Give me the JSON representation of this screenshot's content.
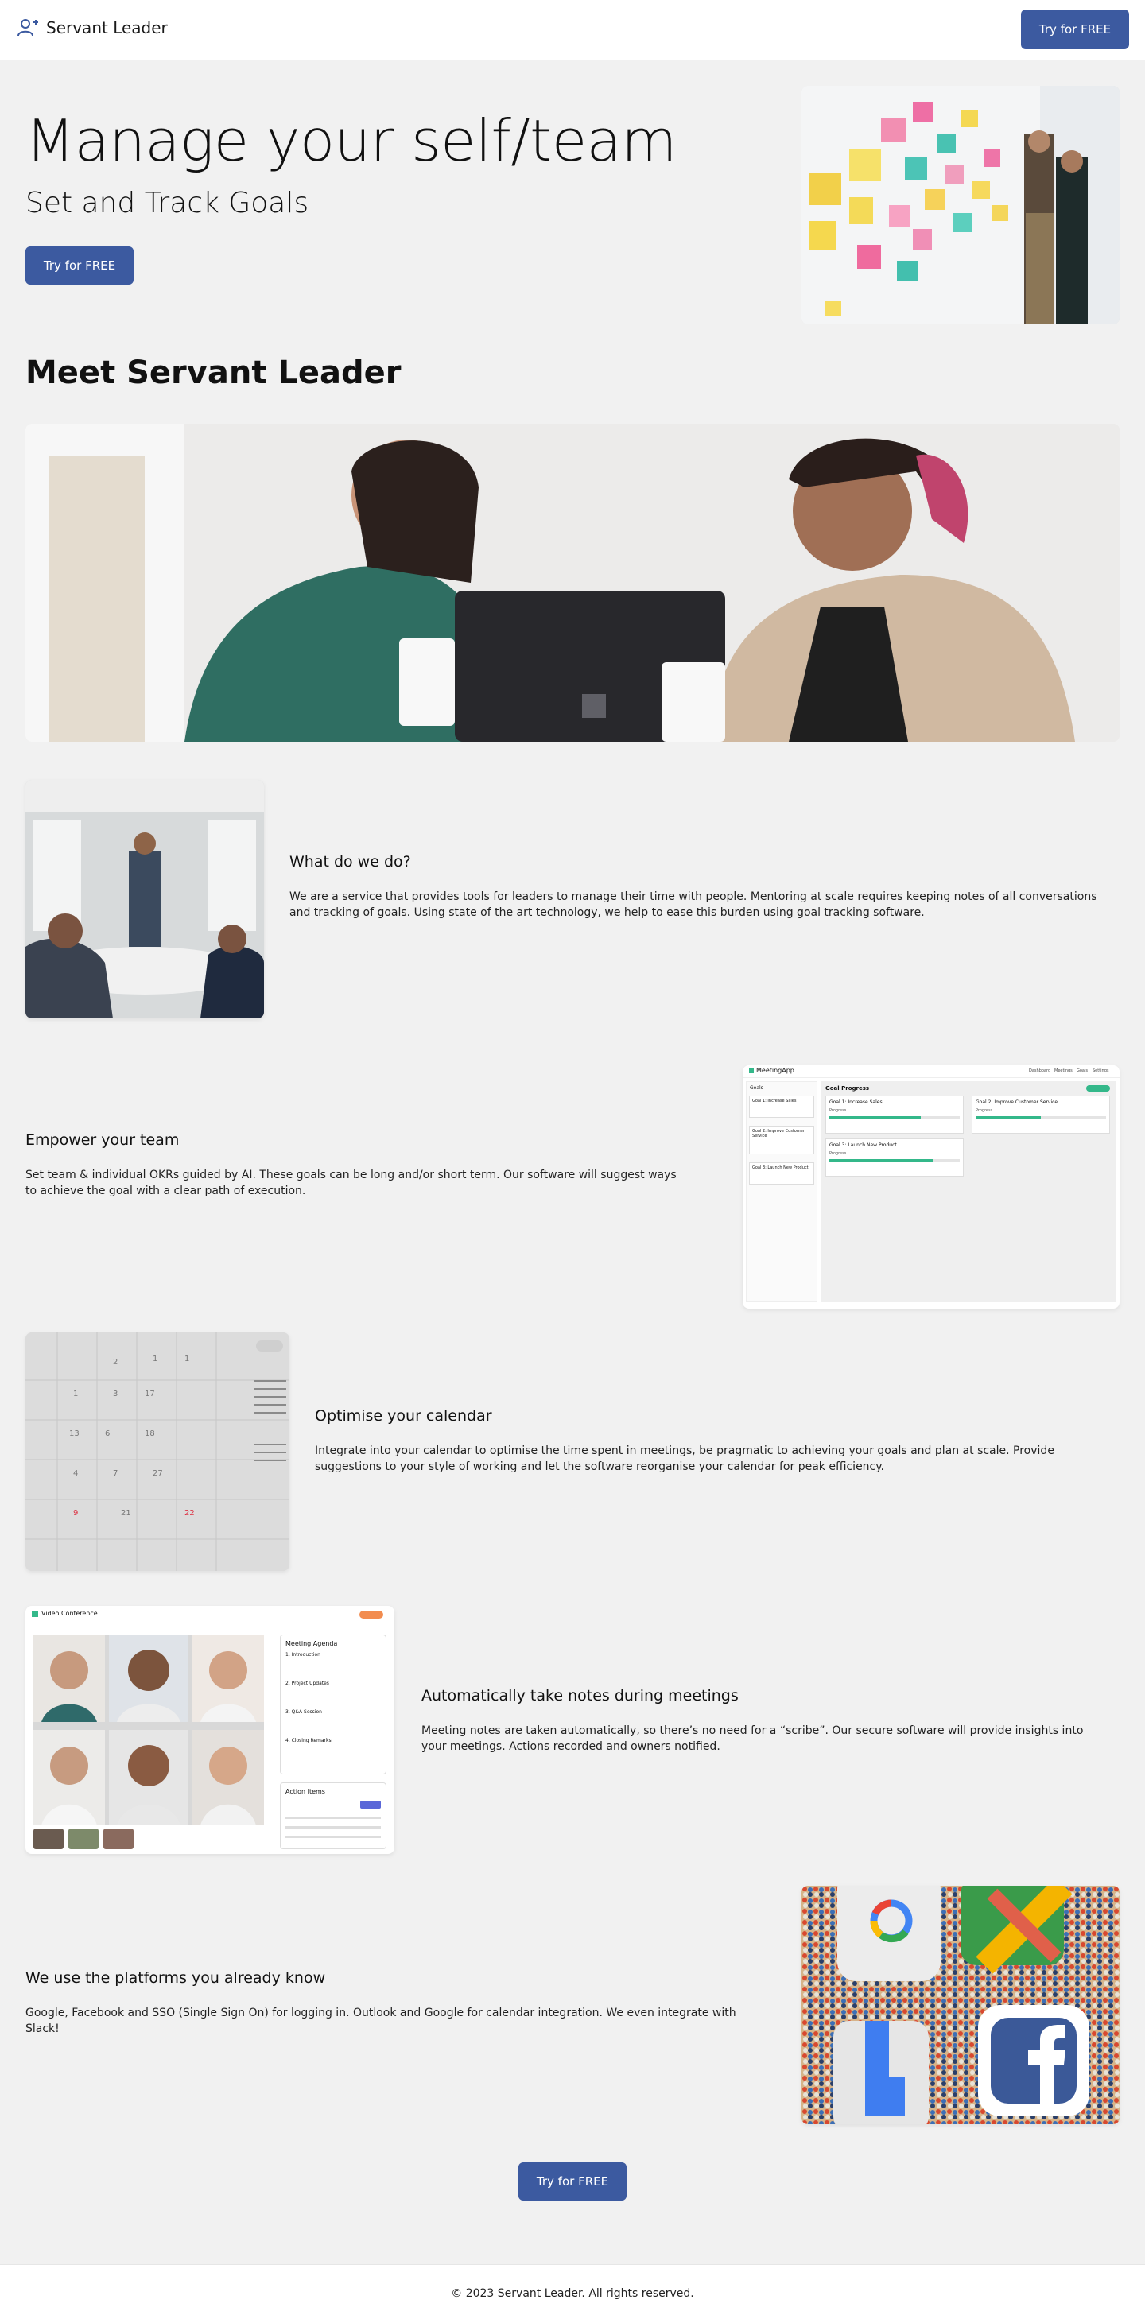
{
  "nav": {
    "brand": "Servant Leader",
    "brand_icon": "add-user-icon",
    "cta": "Try for FREE"
  },
  "hero": {
    "title": "Manage your self/team",
    "subtitle": "Set and Track Goals",
    "cta": "Try for FREE"
  },
  "meet": {
    "title": "Meet Servant Leader"
  },
  "features": [
    {
      "title": "What do we do?",
      "body": "We are a service that provides tools for leaders to manage their time with people. Mentoring at scale requires keeping notes of all conversations and tracking of goals. Using state of the art technology, we help to ease this burden using goal tracking software."
    },
    {
      "title": "Empower your team",
      "body": "Set team & individual OKRs guided by AI. These goals can be long and/or short term. Our software will suggest ways to achieve the goal with a clear path of execution."
    },
    {
      "title": "Optimise your calendar",
      "body": "Integrate into your calendar to optimise the time spent in meetings, be pragmatic to achieving your goals and plan at scale. Provide suggestions to your style of working and let the software reorganise your calendar for peak efficiency."
    },
    {
      "title": "Automatically take notes during meetings",
      "body": "Meeting notes are taken automatically, so there’s no need for a “scribe”. Our secure software will provide insights into your meetings. Actions recorded and owners notified."
    },
    {
      "title": "We use the platforms you already know",
      "body": "Google, Facebook and SSO (Single Sign On) for logging in. Outlook and Google for calendar integration. We even integrate with Slack!"
    }
  ],
  "goal_app": {
    "app_name": "MeetingApp",
    "nav_items": [
      "Dashboard",
      "Meetings",
      "Goals",
      "Settings"
    ],
    "sidebar_title": "Goals",
    "sidebar_goals": [
      "Goal 1: Increase Sales",
      "Goal 2: Improve Customer Service",
      "Goal 3: Launch New Product"
    ],
    "main_title": "Goal Progress",
    "cards": [
      {
        "title": "Goal 1: Increase Sales",
        "progress": 0.7
      },
      {
        "title": "Goal 2: Improve Customer Service",
        "progress": 0.5
      },
      {
        "title": "Goal 3: Launch New Product",
        "progress": 0.8
      }
    ],
    "progress_label": "Progress",
    "accent": "#34b88a"
  },
  "video_app": {
    "title": "Video Conference",
    "agenda_title": "Meeting Agenda",
    "agenda_items": [
      "1. Introduction",
      "2. Project Updates",
      "3. Q&A Session",
      "4. Closing Remarks"
    ],
    "actions_title": "Action Items",
    "accent": "#f28c4f"
  },
  "cta": "Try for FREE",
  "footer": {
    "text": "© 2023 Servant Leader. All rights reserved."
  },
  "colors": {
    "primary": "#3c5aa0",
    "background": "#f1f1f1"
  }
}
